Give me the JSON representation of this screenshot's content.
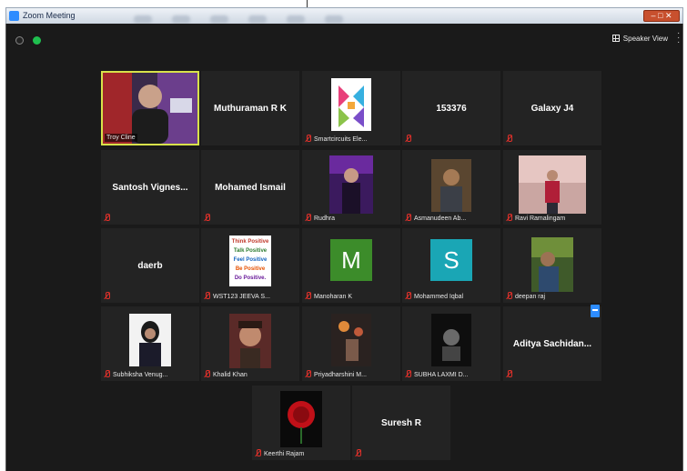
{
  "window": {
    "title": "Zoom Meeting",
    "controls_label": "– □ ✕"
  },
  "toolbar": {
    "speaker_view_label": "Speaker View"
  },
  "icons": {
    "info": "info-icon",
    "secure": "shield-check-icon",
    "speaker_view": "grid-icon",
    "more": "more-vertical-icon",
    "mute": "mic-muted-icon"
  },
  "colors": {
    "active_speaker_border": "#d8e24a",
    "muted": "#e0302a",
    "tile_bg": "#232323",
    "meeting_bg": "#1a1a1a",
    "avatar_m": "#3c8c2a",
    "avatar_s": "#1aa6b5"
  },
  "participants": [
    {
      "name": "Troy Cline",
      "kind": "video",
      "active": true,
      "muted": false
    },
    {
      "name": "Muthuraman R K",
      "kind": "name",
      "muted": false
    },
    {
      "name": "Smartcircuits Ele...",
      "kind": "logo",
      "muted": true
    },
    {
      "name": "153376",
      "kind": "name",
      "muted": true
    },
    {
      "name": "Galaxy J4",
      "kind": "name",
      "muted": true
    },
    {
      "name": "Santosh  Vignes...",
      "kind": "name",
      "muted": true
    },
    {
      "name": "Mohamed Ismail",
      "kind": "name",
      "muted": true
    },
    {
      "name": "Rudhra",
      "kind": "photo",
      "muted": true
    },
    {
      "name": "Asmanudeen Ab...",
      "kind": "photo",
      "muted": true
    },
    {
      "name": "Ravi Ramalingam",
      "kind": "photo",
      "muted": true
    },
    {
      "name": "daerb",
      "kind": "name",
      "muted": true
    },
    {
      "name": "WST123 JEEVA S...",
      "kind": "poster",
      "muted": true,
      "poster_lines": [
        "Think Positive",
        "Talk Positive",
        "Feel Positive",
        "Be Positive",
        "Do Positive."
      ]
    },
    {
      "name": "Manoharan K",
      "kind": "letter",
      "letter": "M",
      "muted": true
    },
    {
      "name": "Mohammed Iqbal",
      "kind": "letter",
      "letter": "S",
      "muted": true
    },
    {
      "name": "deepan raj",
      "kind": "photo",
      "muted": true
    },
    {
      "name": "Subhiksha Venug...",
      "kind": "photo",
      "muted": true
    },
    {
      "name": "Khalid Khan",
      "kind": "photo",
      "muted": true
    },
    {
      "name": "Priyadharshini M...",
      "kind": "photo",
      "muted": true
    },
    {
      "name": "SUBHA LAXMI D...",
      "kind": "photo",
      "muted": true
    },
    {
      "name": "Aditya  Sachidan...",
      "kind": "name",
      "muted": true
    },
    {
      "name": "Keerthi Rajam",
      "kind": "photo",
      "muted": true
    },
    {
      "name": "Suresh R",
      "kind": "name",
      "muted": true
    }
  ]
}
